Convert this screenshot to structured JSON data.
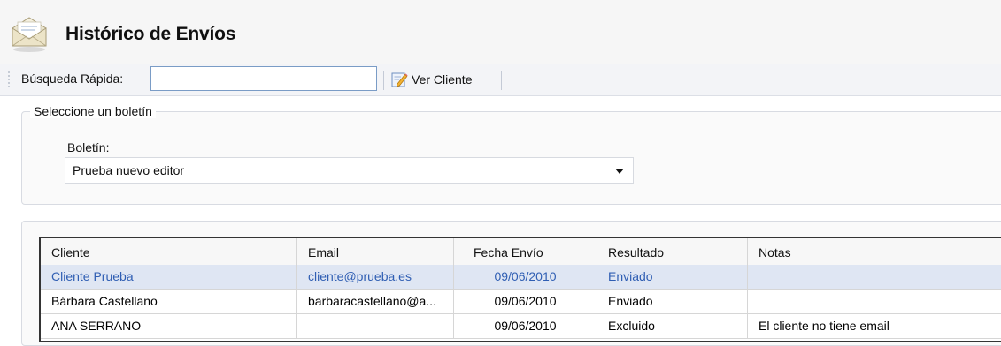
{
  "header": {
    "title": "Histórico de Envíos",
    "icon": "envelope-icon"
  },
  "toolbar": {
    "quick_search_label": "Búsqueda Rápida:",
    "quick_search_value": "",
    "ver_cliente_label": "Ver Cliente",
    "ver_cliente_icon": "edit-pencil-icon"
  },
  "selector": {
    "group_title": "Seleccione un boletín",
    "boletin_label": "Boletín:",
    "boletin_selected": "Prueba nuevo editor"
  },
  "table": {
    "columns": [
      "Cliente",
      "Email",
      "Fecha Envío",
      "Resultado",
      "Notas"
    ],
    "rows": [
      {
        "cliente": "Cliente Prueba",
        "email": "cliente@prueba.es",
        "fecha": "09/06/2010",
        "resultado": "Enviado",
        "notas": "",
        "selected": true
      },
      {
        "cliente": "Bárbara Castellano",
        "email": "barbaracastellano@a...",
        "fecha": "09/06/2010",
        "resultado": "Enviado",
        "notas": "",
        "selected": false
      },
      {
        "cliente": "ANA SERRANO",
        "email": "",
        "fecha": "09/06/2010",
        "resultado": "Excluido",
        "notas": "El cliente no tiene email",
        "selected": false
      }
    ]
  },
  "colors": {
    "selected_row_bg": "#dfe6f3",
    "selected_row_text": "#2f5eb3",
    "input_border": "#7a9cc6"
  }
}
